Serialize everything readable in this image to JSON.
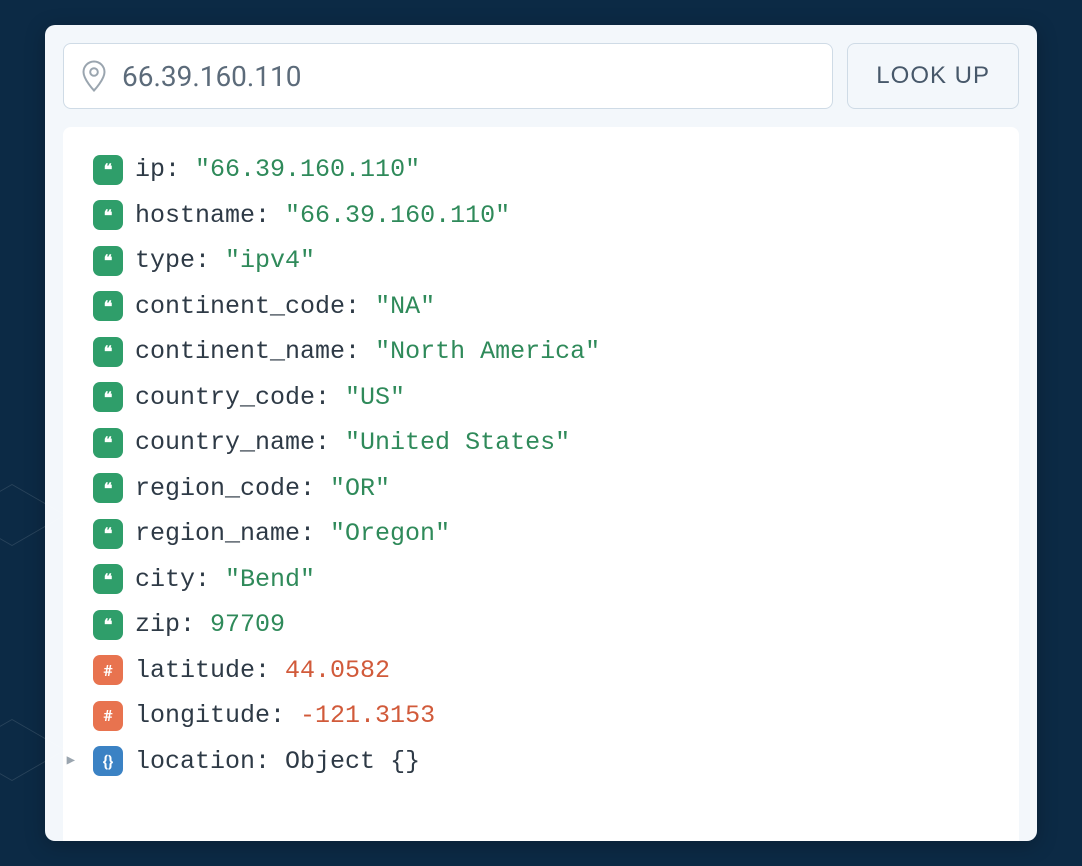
{
  "search": {
    "value": "66.39.160.110",
    "button_label": "LOOK UP"
  },
  "badges": {
    "string_glyph": "❝",
    "number_glyph": "#",
    "object_glyph": "{}"
  },
  "results": [
    {
      "type": "string",
      "key": "ip",
      "value": "\"66.39.160.110\""
    },
    {
      "type": "string",
      "key": "hostname",
      "value": "\"66.39.160.110\""
    },
    {
      "type": "string",
      "key": "type",
      "value": "\"ipv4\""
    },
    {
      "type": "string",
      "key": "continent_code",
      "value": "\"NA\""
    },
    {
      "type": "string",
      "key": "continent_name",
      "value": "\"North America\""
    },
    {
      "type": "string",
      "key": "country_code",
      "value": "\"US\""
    },
    {
      "type": "string",
      "key": "country_name",
      "value": "\"United States\""
    },
    {
      "type": "string",
      "key": "region_code",
      "value": "\"OR\""
    },
    {
      "type": "string",
      "key": "region_name",
      "value": "\"Oregon\""
    },
    {
      "type": "string",
      "key": "city",
      "value": "\"Bend\""
    },
    {
      "type": "string",
      "key": "zip",
      "value": "97709"
    },
    {
      "type": "number",
      "key": "latitude",
      "value": "44.0582"
    },
    {
      "type": "number",
      "key": "longitude",
      "value": "-121.3153"
    },
    {
      "type": "object",
      "key": "location",
      "value": "Object {}",
      "expandable": true
    }
  ]
}
